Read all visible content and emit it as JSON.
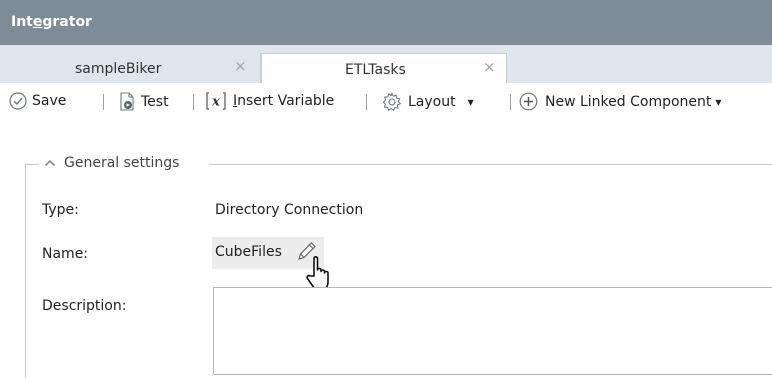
{
  "app": {
    "title_pre": "Int",
    "title_mnemonic": "e",
    "title_post": "grator"
  },
  "tabs": [
    {
      "label": "sampleBiker",
      "close": "×",
      "active": false
    },
    {
      "label": "ETLTasks",
      "close": "×",
      "active": true
    }
  ],
  "toolbar": {
    "save_label": "Save",
    "test_label": "Test",
    "insert_variable_mnemonic": "I",
    "insert_variable_rest": "nsert Variable",
    "layout_label": "Layout",
    "new_linked_label": "New Linked Component",
    "dropdown_arrow": "▾"
  },
  "section": {
    "title": "General settings",
    "fields": {
      "type_label": "Type:",
      "type_value": "Directory Connection",
      "name_label": "Name:",
      "name_value": "CubeFiles",
      "description_label": "Description:",
      "description_value": ""
    }
  },
  "icons": [
    "check-circle-icon",
    "test-document-icon",
    "variable-x-icon",
    "gear-icon",
    "plus-circle-icon",
    "chevron-up-icon",
    "pencil-icon",
    "hand-cursor-icon"
  ]
}
